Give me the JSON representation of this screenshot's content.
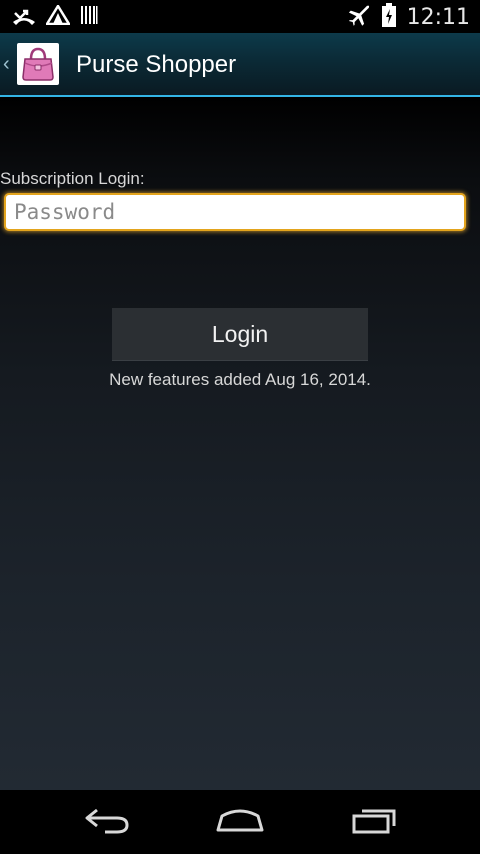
{
  "status_bar": {
    "icons": [
      "missed-call-icon",
      "wifi-signal-icon",
      "barcode-icon",
      "airplane-mode-icon",
      "battery-charging-icon"
    ],
    "time": "12:11"
  },
  "action_bar": {
    "title": "Purse Shopper",
    "icon": "purse-icon",
    "accent_color": "#33b5e5"
  },
  "login_form": {
    "label": "Subscription Login:",
    "password_placeholder": "Password",
    "password_value": "",
    "login_label": "Login",
    "info_text": "New features added Aug 16, 2014.",
    "focus_color": "#e3a41d"
  },
  "nav_bar": {
    "buttons": [
      "back-icon",
      "home-icon",
      "recent-apps-icon"
    ]
  }
}
